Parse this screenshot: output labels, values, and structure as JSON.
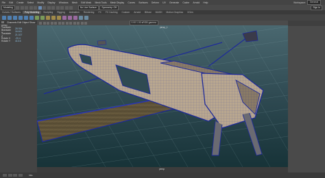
{
  "menubar": {
    "items": [
      "File",
      "Edit",
      "Create",
      "Select",
      "Modify",
      "Display",
      "Windows",
      "Mesh",
      "Edit Mesh",
      "Mesh Tools",
      "Mesh Display",
      "Curves",
      "Surfaces",
      "Deform",
      "UV",
      "Generate",
      "Cache",
      "Arnold",
      "Help"
    ],
    "workspace_label": "Workspace:",
    "workspace_value": "General"
  },
  "statusline": {
    "mode": "Modeling",
    "live_surface": "No Live Surface",
    "symmetry": "Symmetry: Off",
    "sign_in": "Sign In"
  },
  "shelf": {
    "tabs": [
      "Curves / Surfaces",
      "Poly Modeling",
      "Sculpting",
      "Rigging",
      "Animation",
      "Rendering",
      "FX",
      "FX Caching",
      "Custom",
      "Arnold",
      "Bifrost",
      "MASH",
      "Motion Graphics",
      "XGen"
    ],
    "active_tab": "Poly Modeling"
  },
  "channel_box": {
    "header": "Channels  Edit  Object  Show",
    "rows": [
      {
        "k": "persp",
        "v": ""
      },
      {
        "k": "Translate X",
        "v": "28.934"
      },
      {
        "k": "Translate Y",
        "v": "16.611"
      },
      {
        "k": "Translate Z",
        "v": "21.027"
      },
      {
        "k": "Rotate X",
        "v": "-20.4"
      },
      {
        "k": "Rotate Y",
        "v": "413.6"
      }
    ]
  },
  "viewport": {
    "menu": [
      "View",
      "Shading",
      "Lighting",
      "Show",
      "Renderer",
      "Panels"
    ],
    "camera_field": "0.00   1.00   sRGB gamma",
    "camera_label": "persp_1",
    "persp_label": "persp",
    "colors": {
      "bg_top": "#2f4a52",
      "bg_bottom": "#1a3a40",
      "wood": "#6b5a3e",
      "wire": "#1e2a9a",
      "stock": "#b8a48a"
    }
  },
  "timebar": {
    "cmd_label": "MEL"
  }
}
